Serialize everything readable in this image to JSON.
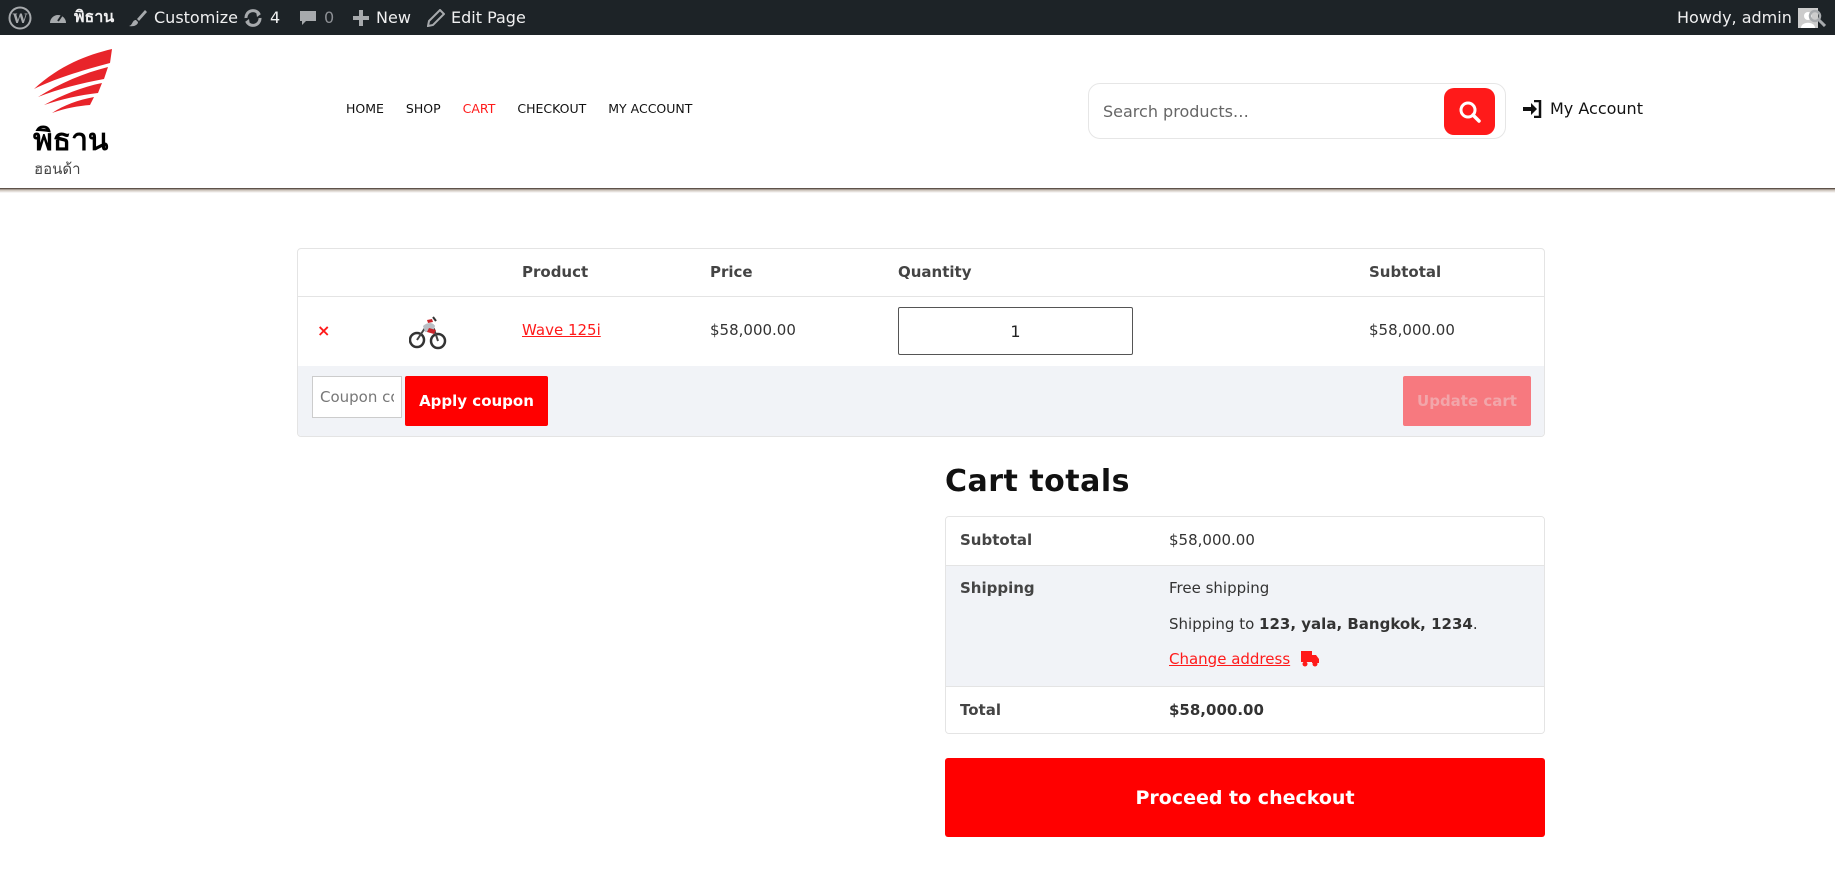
{
  "admin_bar": {
    "site_name": "พิธาน",
    "customize": "Customize",
    "updates_count": "4",
    "comments_count": "0",
    "new": "New",
    "edit_page": "Edit Page",
    "howdy": "Howdy, admin"
  },
  "header": {
    "site_title": "พิธาน",
    "tagline": "ฮอนด้า",
    "nav": [
      "HOME",
      "SHOP",
      "CART",
      "CHECKOUT",
      "MY ACCOUNT"
    ],
    "active_nav": "CART",
    "search_placeholder": "Search products…",
    "account_label": "My Account"
  },
  "cart": {
    "headers": {
      "product": "Product",
      "price": "Price",
      "quantity": "Quantity",
      "subtotal": "Subtotal"
    },
    "items": [
      {
        "remove": "×",
        "name": "Wave 125i",
        "price": "$58,000.00",
        "quantity": "1",
        "subtotal": "$58,000.00"
      }
    ],
    "coupon_placeholder": "Coupon code",
    "apply_coupon": "Apply coupon",
    "update_cart": "Update cart"
  },
  "totals": {
    "title": "Cart totals",
    "subtotal_label": "Subtotal",
    "subtotal_value": "$58,000.00",
    "shipping_label": "Shipping",
    "shipping_method": "Free shipping",
    "shipping_to_prefix": "Shipping to",
    "shipping_address": "123, yala, Bangkok, 1234",
    "change_address": "Change address",
    "total_label": "Total",
    "total_value": "$58,000.00",
    "checkout": "Proceed to checkout"
  },
  "colors": {
    "accent": "#ff0000",
    "admin_bar": "#1d2327",
    "actions_bg": "#f1f3f7"
  }
}
